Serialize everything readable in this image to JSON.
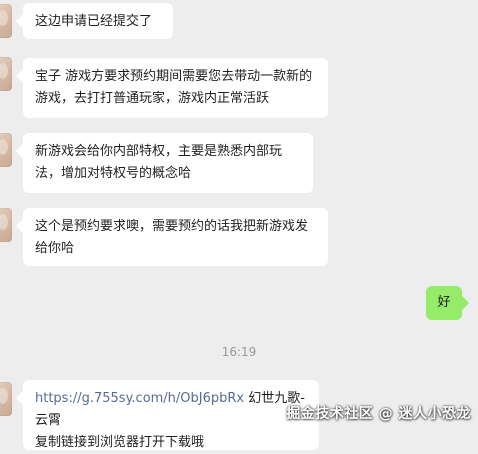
{
  "chat": {
    "messages": [
      {
        "text": "这边申请已经提交了"
      },
      {
        "text": "宝子 游戏方要求预约期间需要您去带动一款新的游戏，去打打普通玩家，游戏内正常活跃"
      },
      {
        "text": "新游戏会给你内部特权，主要是熟悉内部玩法，增加对特权号的概念哈"
      },
      {
        "text": "这个是预约要求噢，需要预约的话我把新游戏发给你哈"
      },
      {
        "text": "好"
      },
      {
        "link": "https://g.755sy.com/h/ObJ6pbRx",
        "text_after_link": "  幻世九歌-云霄",
        "line3": "复制链接到浏览器打开下载哦"
      }
    ],
    "timestamp": "16:19"
  },
  "watermark": {
    "text": "掘金技术社区 @ 迷人小恐龙"
  }
}
